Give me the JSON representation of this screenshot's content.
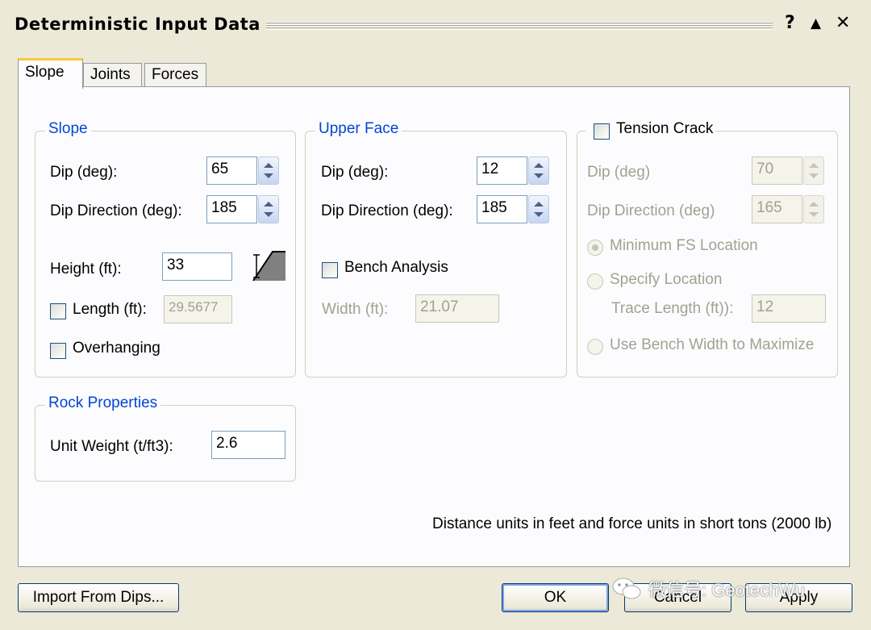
{
  "window": {
    "title": "Deterministic Input Data",
    "help": "?",
    "collapse": "▲",
    "close": "✕"
  },
  "tabs": [
    {
      "label": "Slope",
      "active": true
    },
    {
      "label": "Joints",
      "active": false
    },
    {
      "label": "Forces",
      "active": false
    }
  ],
  "slope": {
    "title": "Slope",
    "dip_label": "Dip (deg):",
    "dip_value": "65",
    "dipdir_label": "Dip Direction (deg):",
    "dipdir_value": "185",
    "height_label": "Height (ft):",
    "height_value": "33",
    "length_label": "Length (ft):",
    "length_value": "29.5677",
    "length_checked": false,
    "overhanging_label": "Overhanging",
    "overhanging_checked": false
  },
  "upper_face": {
    "title": "Upper Face",
    "dip_label": "Dip (deg):",
    "dip_value": "12",
    "dipdir_label": "Dip Direction (deg):",
    "dipdir_value": "185",
    "bench_label": "Bench Analysis",
    "bench_checked": false,
    "width_label": "Width (ft):",
    "width_value": "21.07"
  },
  "tension_crack": {
    "title": "Tension Crack",
    "checked": false,
    "dip_label": "Dip (deg)",
    "dip_value": "70",
    "dipdir_label": "Dip Direction (deg)",
    "dipdir_value": "165",
    "min_fs_label": "Minimum FS Location",
    "specify_label": "Specify Location",
    "trace_label": "Trace Length (ft)):",
    "trace_value": "12",
    "bench_width_label": "Use Bench Width to Maximize"
  },
  "rock": {
    "title": "Rock Properties",
    "unit_weight_label": "Unit Weight (t/ft3):",
    "unit_weight_value": "2.6"
  },
  "units_note": "Distance units in feet and force units in short tons (2000 lb)",
  "buttons": {
    "import": "Import From Dips...",
    "ok": "OK",
    "cancel": "Cancel",
    "apply": "Apply"
  },
  "watermark": "微信号: GeotechWu"
}
